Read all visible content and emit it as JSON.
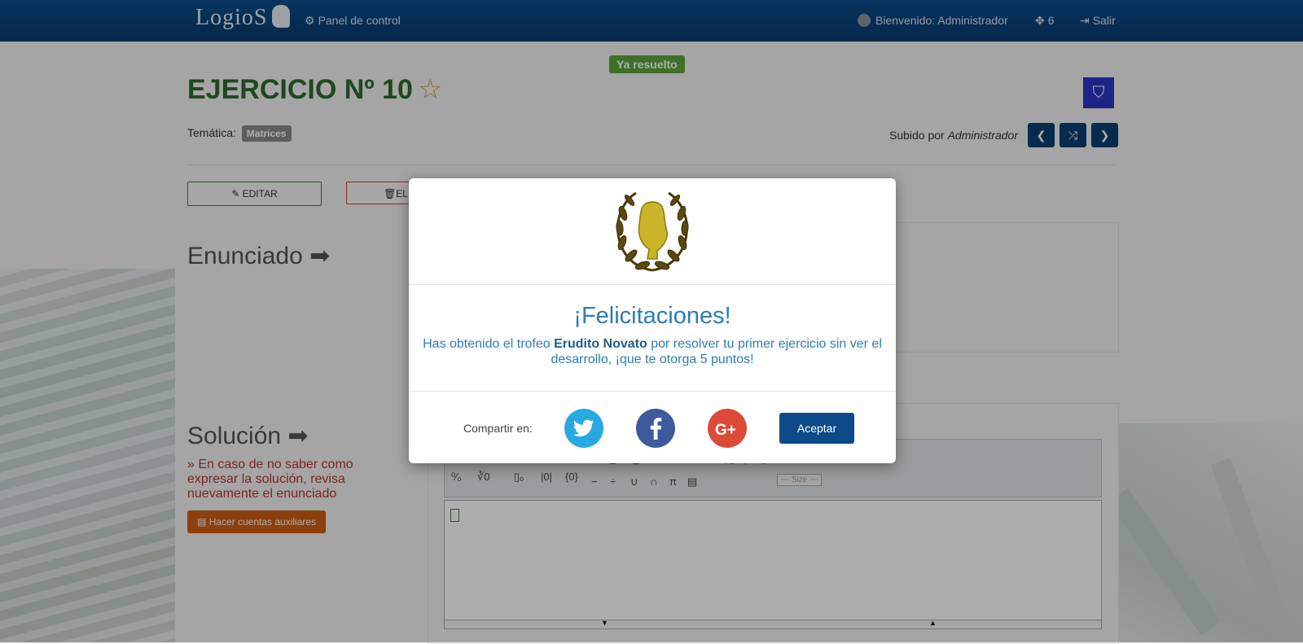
{
  "navbar": {
    "brand": "LogioS",
    "panel_label": "Panel de control",
    "welcome_label": "Bienvenido: Administrador",
    "points": "6",
    "logout_label": "Salir"
  },
  "exercise": {
    "status_badge": "Ya resuelto",
    "title": "EJERCICIO Nº 10",
    "topic_label": "Temática:",
    "topic_tag": "Matrices",
    "uploaded_label": "Subido por",
    "uploaded_by": "Administrador",
    "edit_label": "EDITAR",
    "delete_label": "EL"
  },
  "sections": {
    "enunciado": "Enunciado",
    "solucion": "Solución",
    "hint": "» En caso de no saber como expresar la solución, revisa nuevamente el enunciado",
    "aux_button": "Hacer cuentas auxiliares"
  },
  "toolbar": {
    "size_placeholder": "--- Size ---"
  },
  "modal": {
    "heading": "¡Felicitaciones!",
    "msg_before": "Has obtenido el trofeo ",
    "trophy_name": "Erudito Novato",
    "msg_after": " por resolver tu primer ejercicio sin ver el desarrollo, ¡que te otorga 5 puntos!",
    "share_label": "Compartir en:",
    "accept_label": "Aceptar"
  },
  "colors": {
    "navbar": "#0b4a86",
    "title_green": "#2e6b2e",
    "modal_text": "#2d7db5",
    "twitter": "#28a9e2",
    "facebook": "#3d5a9a",
    "googleplus": "#dc4a38",
    "accept": "#0d4a8a"
  }
}
